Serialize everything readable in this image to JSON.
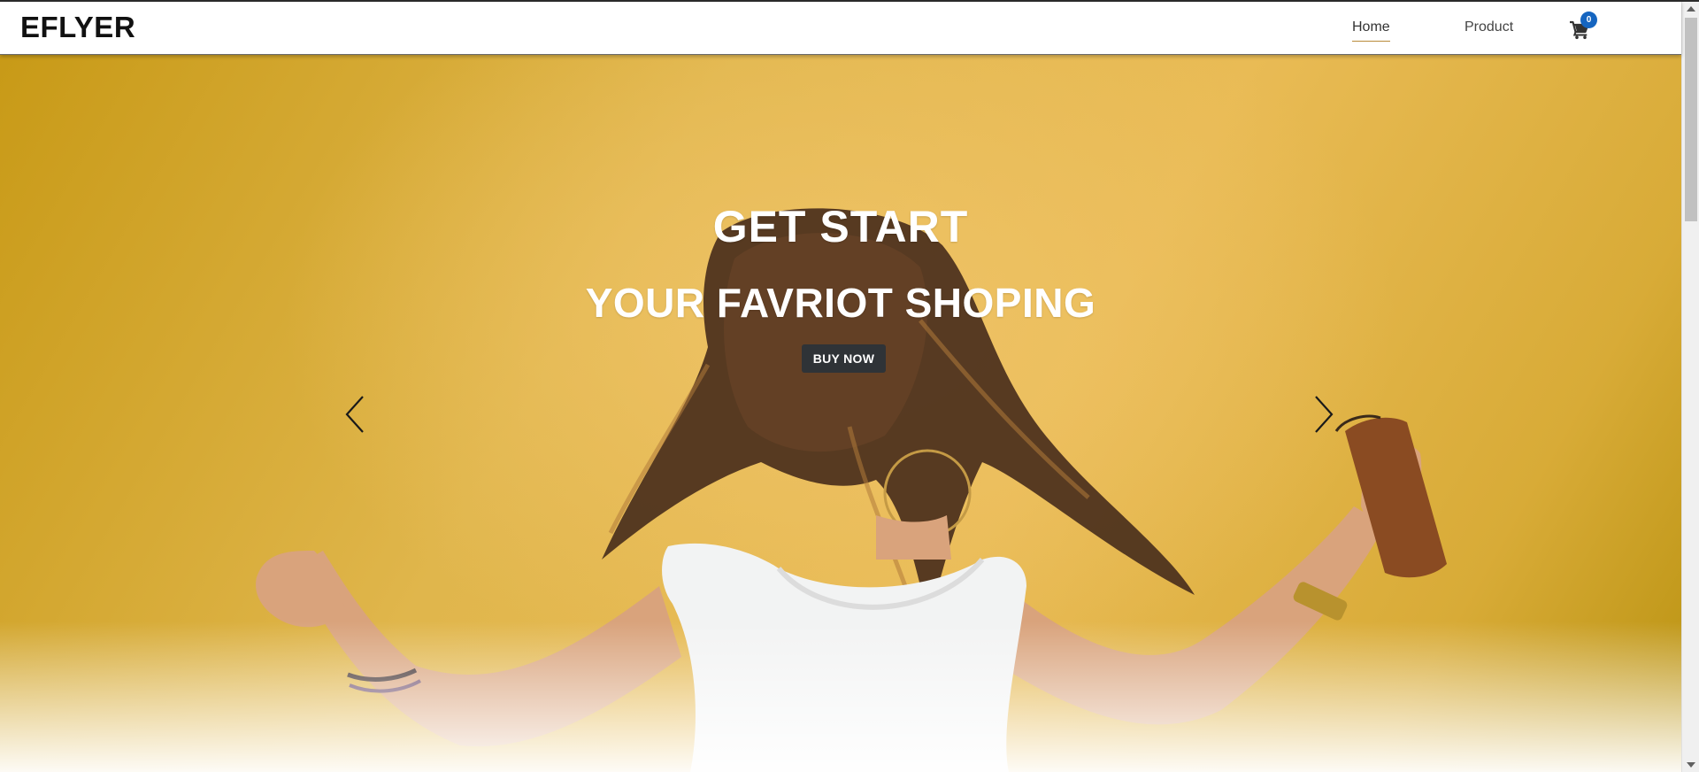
{
  "brand": {
    "name": "EFLYER"
  },
  "nav": {
    "items": [
      {
        "label": "Home",
        "active": true
      },
      {
        "label": "Product",
        "active": false
      }
    ],
    "cart_icon": "shopping-cart-icon",
    "cart_count": "0"
  },
  "hero": {
    "title": "GET START",
    "subtitle": "YOUR FAVRIOT SHOPING",
    "cta_label": "BUY NOW",
    "prev_icon": "chevron-left-icon",
    "next_icon": "chevron-right-icon"
  },
  "colors": {
    "accent": "#b98a3a",
    "badge": "#1565c0",
    "button": "#2f3337",
    "hero_background": "#e0b64c"
  }
}
